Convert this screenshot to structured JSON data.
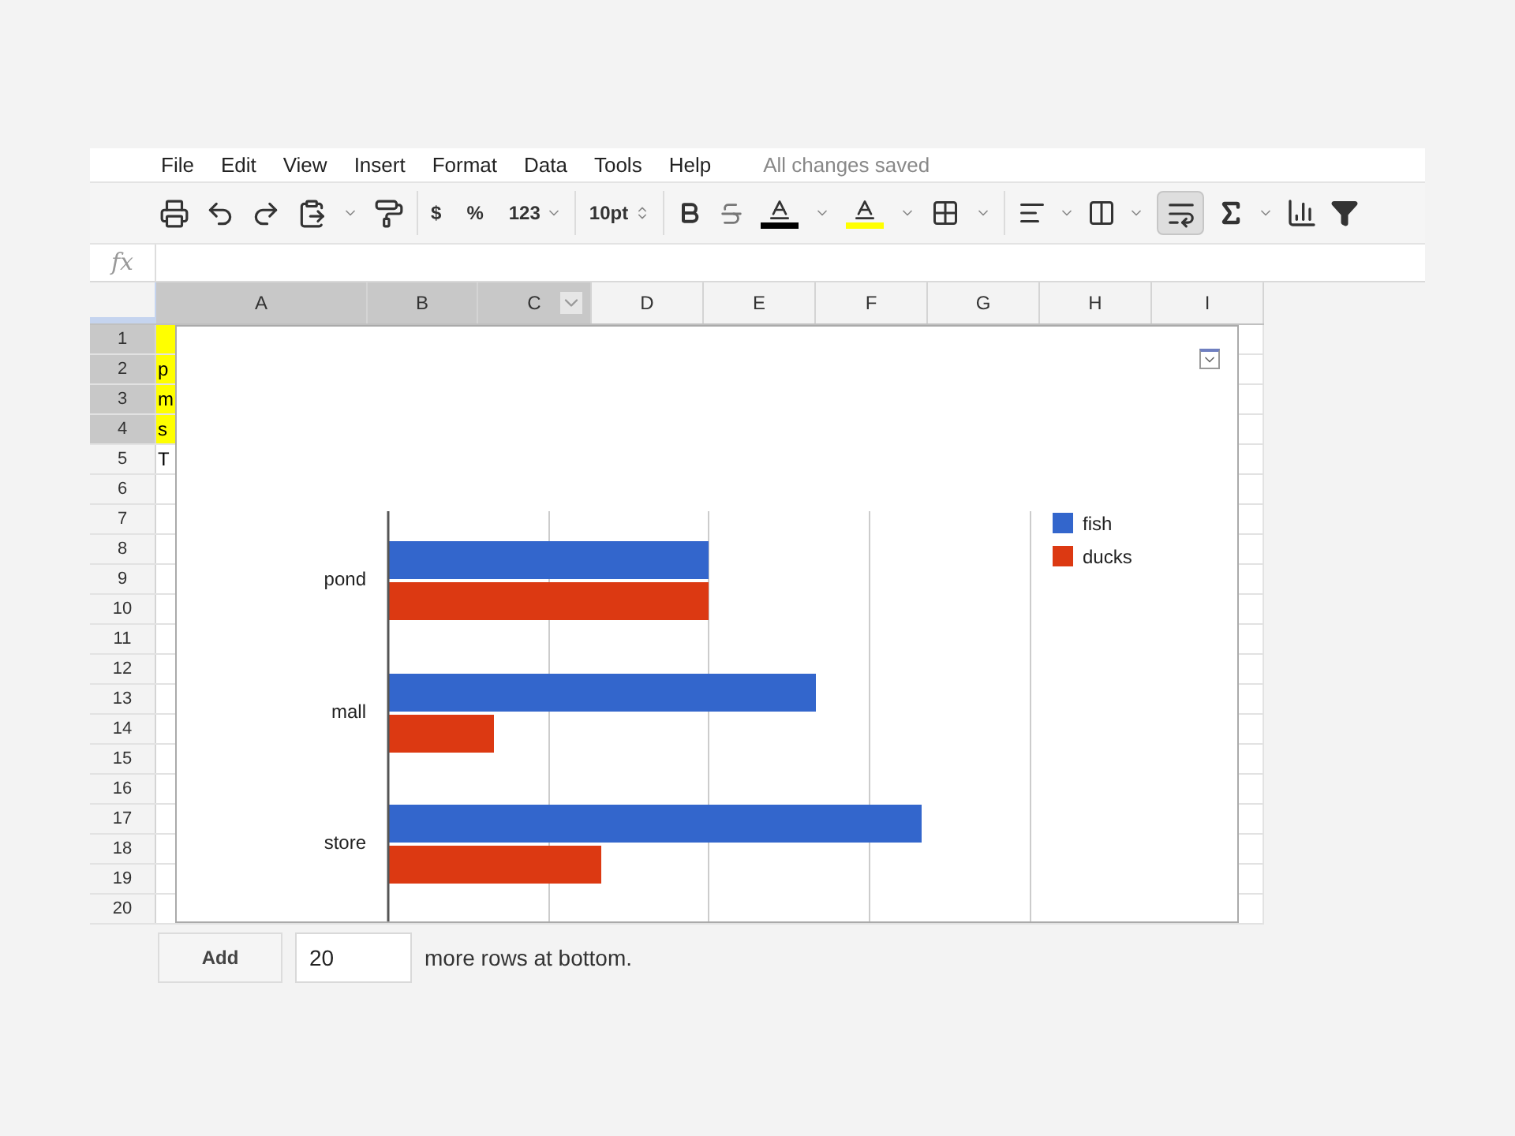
{
  "menu": {
    "items": [
      "File",
      "Edit",
      "View",
      "Insert",
      "Format",
      "Data",
      "Tools",
      "Help"
    ],
    "status": "All changes saved"
  },
  "toolbar": {
    "currency": "$",
    "percent": "%",
    "number_format": "123",
    "font_size": "10pt",
    "wrap_text_selected": true
  },
  "formula_bar": {
    "label": "fx"
  },
  "columns": [
    {
      "label": "A",
      "selected": true
    },
    {
      "label": "B",
      "selected": true
    },
    {
      "label": "C",
      "selected": true
    },
    {
      "label": "D",
      "selected": false
    },
    {
      "label": "E",
      "selected": false
    },
    {
      "label": "F",
      "selected": false
    },
    {
      "label": "G",
      "selected": false
    },
    {
      "label": "H",
      "selected": false
    },
    {
      "label": "I",
      "selected": false
    }
  ],
  "rows": [
    {
      "number": "1",
      "selected": true,
      "highlighted": true
    },
    {
      "number": "2",
      "selected": true,
      "highlighted": true,
      "cell_a": "p"
    },
    {
      "number": "3",
      "selected": true,
      "highlighted": true,
      "cell_a": "m"
    },
    {
      "number": "4",
      "selected": true,
      "highlighted": true,
      "cell_a": "s"
    },
    {
      "number": "5",
      "selected": false,
      "highlighted": false,
      "cell_a": "T"
    },
    {
      "number": "6",
      "selected": false,
      "highlighted": false
    },
    {
      "number": "7",
      "selected": false,
      "highlighted": false
    },
    {
      "number": "8",
      "selected": false,
      "highlighted": false
    },
    {
      "number": "9",
      "selected": false,
      "highlighted": false
    },
    {
      "number": "10",
      "selected": false,
      "highlighted": false
    },
    {
      "number": "11",
      "selected": false,
      "highlighted": false
    },
    {
      "number": "12",
      "selected": false,
      "highlighted": false
    },
    {
      "number": "13",
      "selected": false,
      "highlighted": false
    },
    {
      "number": "14",
      "selected": false,
      "highlighted": false
    },
    {
      "number": "15",
      "selected": false,
      "highlighted": false
    },
    {
      "number": "16",
      "selected": false,
      "highlighted": false
    },
    {
      "number": "17",
      "selected": false,
      "highlighted": false
    },
    {
      "number": "18",
      "selected": false,
      "highlighted": false
    },
    {
      "number": "19",
      "selected": false,
      "highlighted": false
    },
    {
      "number": "20",
      "selected": false,
      "highlighted": false
    }
  ],
  "chart": {
    "categories": [
      "pond",
      "mall",
      "store"
    ],
    "legend": [
      {
        "name": "fish",
        "color": "#3366cc"
      },
      {
        "name": "ducks",
        "color": "#dc3912"
      }
    ]
  },
  "add_rows": {
    "button": "Add",
    "value": "20",
    "text": "more rows at bottom."
  }
}
